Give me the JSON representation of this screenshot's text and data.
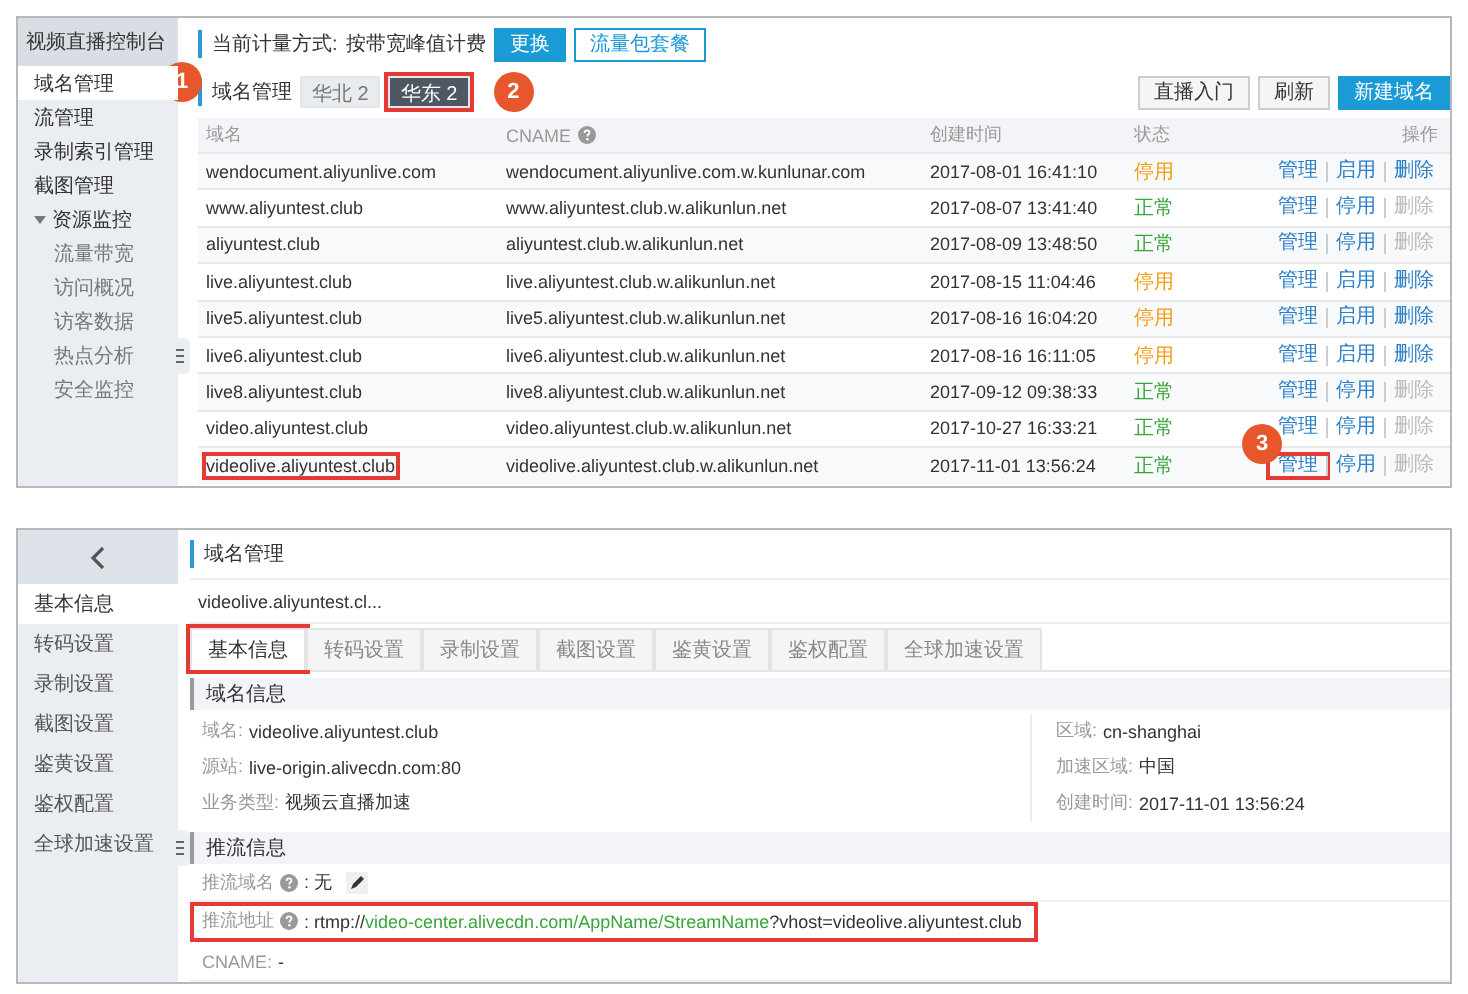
{
  "top_panel": {
    "sidebar": {
      "title": "视频直播控制台",
      "items": [
        {
          "label": "域名管理",
          "selected": true,
          "callout": "1"
        },
        {
          "label": "流管理",
          "selected": false
        },
        {
          "label": "录制索引管理",
          "selected": false
        },
        {
          "label": "截图管理",
          "selected": false
        },
        {
          "label": "资源监控",
          "selected": false,
          "expanded": true,
          "children": [
            {
              "label": "流量带宽",
              "selected": false
            },
            {
              "label": "访问概况",
              "selected": false
            },
            {
              "label": "访客数据",
              "selected": false
            },
            {
              "label": "热点分析",
              "selected": false
            },
            {
              "label": "安全监控",
              "selected": false
            }
          ]
        }
      ]
    },
    "billing": {
      "label": "当前计量方式:",
      "value": "按带宽峰值计费",
      "buttons": [
        {
          "label": "更换",
          "kind": "primary"
        },
        {
          "label": "流量包套餐",
          "kind": "outline"
        }
      ]
    },
    "section_title": "域名管理",
    "regions": [
      {
        "label": "华北 2",
        "selected": false,
        "highlighted": false
      },
      {
        "label": "华东 2",
        "selected": true,
        "highlighted": true
      }
    ],
    "region_callout": "2",
    "toolbar": [
      {
        "label": "直播入门",
        "kind": "default"
      },
      {
        "label": "刷新",
        "kind": "default"
      },
      {
        "label": "新建域名",
        "kind": "primary"
      }
    ],
    "table": {
      "columns": [
        {
          "label": "域名"
        },
        {
          "label": "CNAME",
          "help": true
        },
        {
          "label": "创建时间"
        },
        {
          "label": "状态"
        },
        {
          "label": "操作"
        }
      ],
      "rows": [
        {
          "domain": "wendocument.aliyunlive.com",
          "cname": "wendocument.aliyunlive.com.w.kunlunar.com",
          "created": "2017-08-01 16:41:10",
          "status": {
            "label": "停用",
            "kind": "stopped"
          },
          "actions": [
            {
              "label": "管理",
              "disabled": false
            },
            {
              "label": "启用",
              "disabled": false
            },
            {
              "label": "删除",
              "disabled": false
            }
          ]
        },
        {
          "domain": "www.aliyuntest.club",
          "cname": "www.aliyuntest.club.w.alikunlun.net",
          "created": "2017-08-07 13:41:40",
          "status": {
            "label": "正常",
            "kind": "normal"
          },
          "actions": [
            {
              "label": "管理",
              "disabled": false
            },
            {
              "label": "停用",
              "disabled": false
            },
            {
              "label": "删除",
              "disabled": true
            }
          ]
        },
        {
          "domain": "aliyuntest.club",
          "cname": "aliyuntest.club.w.alikunlun.net",
          "created": "2017-08-09 13:48:50",
          "status": {
            "label": "正常",
            "kind": "normal"
          },
          "actions": [
            {
              "label": "管理",
              "disabled": false
            },
            {
              "label": "停用",
              "disabled": false
            },
            {
              "label": "删除",
              "disabled": true
            }
          ]
        },
        {
          "domain": "live.aliyuntest.club",
          "cname": "live.aliyuntest.club.w.alikunlun.net",
          "created": "2017-08-15 11:04:46",
          "status": {
            "label": "停用",
            "kind": "stopped"
          },
          "actions": [
            {
              "label": "管理",
              "disabled": false
            },
            {
              "label": "启用",
              "disabled": false
            },
            {
              "label": "删除",
              "disabled": false
            }
          ]
        },
        {
          "domain": "live5.aliyuntest.club",
          "cname": "live5.aliyuntest.club.w.alikunlun.net",
          "created": "2017-08-16 16:04:20",
          "status": {
            "label": "停用",
            "kind": "stopped"
          },
          "actions": [
            {
              "label": "管理",
              "disabled": false
            },
            {
              "label": "启用",
              "disabled": false
            },
            {
              "label": "删除",
              "disabled": false
            }
          ]
        },
        {
          "domain": "live6.aliyuntest.club",
          "cname": "live6.aliyuntest.club.w.alikunlun.net",
          "created": "2017-08-16 16:11:05",
          "status": {
            "label": "停用",
            "kind": "stopped"
          },
          "actions": [
            {
              "label": "管理",
              "disabled": false
            },
            {
              "label": "启用",
              "disabled": false
            },
            {
              "label": "删除",
              "disabled": false
            }
          ]
        },
        {
          "domain": "live8.aliyuntest.club",
          "cname": "live8.aliyuntest.club.w.alikunlun.net",
          "created": "2017-09-12 09:38:33",
          "status": {
            "label": "正常",
            "kind": "normal"
          },
          "actions": [
            {
              "label": "管理",
              "disabled": false
            },
            {
              "label": "停用",
              "disabled": false
            },
            {
              "label": "删除",
              "disabled": true
            }
          ]
        },
        {
          "domain": "video.aliyuntest.club",
          "cname": "video.aliyuntest.club.w.alikunlun.net",
          "created": "2017-10-27 16:33:21",
          "status": {
            "label": "正常",
            "kind": "normal"
          },
          "actions": [
            {
              "label": "管理",
              "disabled": false
            },
            {
              "label": "停用",
              "disabled": false
            },
            {
              "label": "删除",
              "disabled": true
            }
          ]
        },
        {
          "domain": "videolive.aliyuntest.club",
          "domain_highlighted": true,
          "callout": "3",
          "cname": "videolive.aliyuntest.club.w.alikunlun.net",
          "created": "2017-11-01 13:56:24",
          "status": {
            "label": "正常",
            "kind": "normal"
          },
          "actions": [
            {
              "label": "管理",
              "disabled": false,
              "highlighted": true
            },
            {
              "label": "停用",
              "disabled": false
            },
            {
              "label": "删除",
              "disabled": true
            }
          ]
        }
      ]
    }
  },
  "bottom_panel": {
    "sidebar": {
      "items": [
        {
          "label": "基本信息",
          "selected": true
        },
        {
          "label": "转码设置",
          "selected": false
        },
        {
          "label": "录制设置",
          "selected": false
        },
        {
          "label": "截图设置",
          "selected": false
        },
        {
          "label": "鉴黄设置",
          "selected": false
        },
        {
          "label": "鉴权配置",
          "selected": false
        },
        {
          "label": "全球加速设置",
          "selected": false
        }
      ]
    },
    "section_title": "域名管理",
    "domain": "videolive.aliyuntest.cl...",
    "tabs": [
      {
        "label": "基本信息",
        "selected": true,
        "highlighted": true
      },
      {
        "label": "转码设置",
        "selected": false
      },
      {
        "label": "录制设置",
        "selected": false
      },
      {
        "label": "截图设置",
        "selected": false
      },
      {
        "label": "鉴黄设置",
        "selected": false
      },
      {
        "label": "鉴权配置",
        "selected": false
      },
      {
        "label": "全球加速设置",
        "selected": false
      }
    ],
    "domain_info": {
      "title": "域名信息",
      "left": [
        {
          "label": "域名:",
          "value": "videolive.aliyuntest.club"
        },
        {
          "label": "源站:",
          "value": "live-origin.alivecdn.com:80"
        },
        {
          "label": "业务类型:",
          "value": "视频云直播加速"
        }
      ],
      "right": [
        {
          "label": "区域:",
          "value": "cn-shanghai"
        },
        {
          "label": "加速区域:",
          "value": "中国"
        },
        {
          "label": "创建时间:",
          "value": "2017-11-01 13:56:24"
        }
      ]
    },
    "push_info": {
      "title": "推流信息",
      "fields": [
        {
          "label": "推流域名",
          "help": true,
          "editable": true,
          "parts": [
            {
              "text": ": 无"
            }
          ]
        },
        {
          "label": "推流地址",
          "help": true,
          "highlighted": true,
          "parts": [
            {
              "text": ": rtmp://"
            },
            {
              "text": "video-center.alivecdn.com/AppName/StreamName",
              "color": "#3aa53a"
            },
            {
              "text": "?vhost=videolive.aliyuntest.club"
            }
          ]
        },
        {
          "label": "CNAME:",
          "parts": [
            {
              "text": " -"
            }
          ]
        }
      ]
    }
  }
}
